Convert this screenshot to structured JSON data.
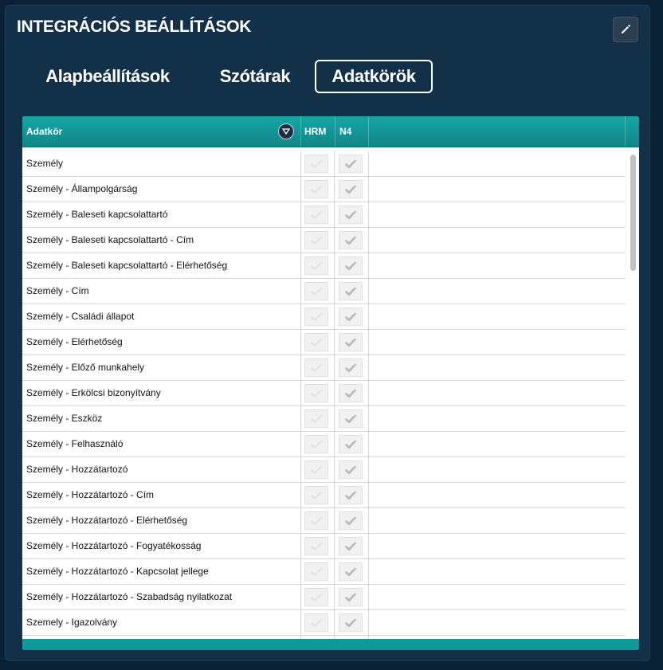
{
  "header": {
    "title": "INTEGRÁCIÓS BEÁLLÍTÁSOK",
    "edit_icon": "pencil-icon"
  },
  "tabs": [
    {
      "label": "Alapbeállítások",
      "active": false
    },
    {
      "label": "Szótárak",
      "active": false
    },
    {
      "label": "Adatkörök",
      "active": true
    }
  ],
  "grid": {
    "columns": [
      "Adatkör",
      "HRM",
      "N4"
    ],
    "filter_icon": "filter-icon",
    "rows": [
      "Személy",
      "Személy - Állampolgárság",
      "Személy - Baleseti kapcsolattartó",
      "Személy - Baleseti kapcsolattartó - Cím",
      "Személy - Baleseti kapcsolattartó - Elérhetőség",
      "Személy - Cím",
      "Személy - Családi állapot",
      "Személy - Elérhetőség",
      "Személy - Előző munkahely",
      "Személy - Erkölcsi bizonyítvány",
      "Személy - Eszköz",
      "Személy - Felhasználó",
      "Személy - Hozzátartozó",
      "Személy - Hozzátartozó - Cím",
      "Személy - Hozzátartozó - Elérhetőség",
      "Személy - Hozzátartozó - Fogyatékosság",
      "Személy - Hozzátartozó - Kapcsolat jellege",
      "Személy - Hozzátartozó - Szabadság nyilatkozat",
      "Szemely - Igazolvány"
    ]
  },
  "colors": {
    "background": "#0b2236",
    "panel": "#133049",
    "header_teal": "#12989a",
    "check_hrm": "#e4e4e4",
    "check_n4": "#b8b8b8"
  }
}
